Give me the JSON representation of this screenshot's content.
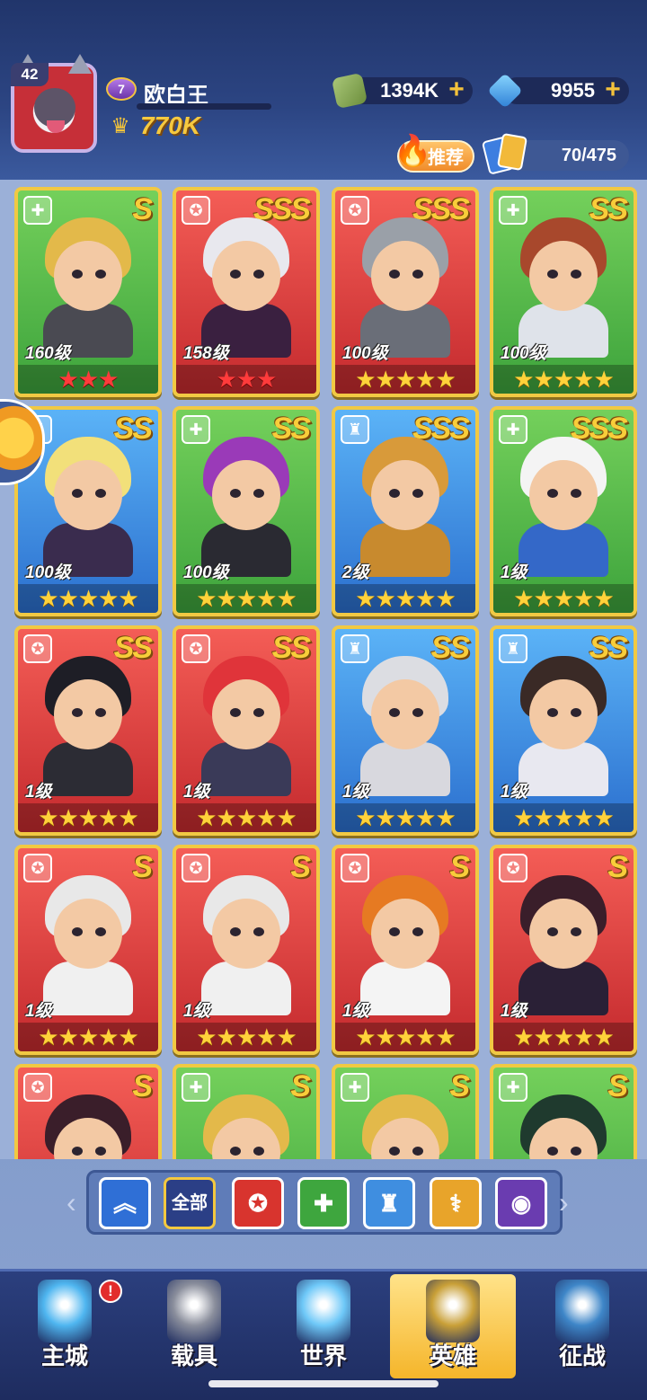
{
  "player": {
    "avatar_level": "42",
    "rank": "7",
    "name": "欧白王",
    "power": "770K"
  },
  "resources": {
    "gold": "1394K",
    "gems": "9955"
  },
  "recommend_label": "推荐",
  "collection_count": "70/475",
  "heroes": [
    {
      "grade": "S",
      "color": "green",
      "level": "160级",
      "stars": 3,
      "star_color": "red",
      "hair": "#e3b94a",
      "outfit": "#4a4a52"
    },
    {
      "grade": "SSS",
      "color": "red",
      "level": "158级",
      "stars": 3,
      "star_color": "red",
      "hair": "#e8e8ee",
      "outfit": "#3a2040"
    },
    {
      "grade": "SSS",
      "color": "red",
      "level": "100级",
      "stars": 5,
      "star_color": "gold",
      "hair": "#9aa0a8",
      "outfit": "#6a6e78"
    },
    {
      "grade": "SS",
      "color": "green",
      "level": "100级",
      "stars": 5,
      "star_color": "gold",
      "hair": "#a8482c",
      "outfit": "#dfe3ea"
    },
    {
      "grade": "SS",
      "color": "blue",
      "level": "100级",
      "stars": 5,
      "star_color": "gold",
      "hair": "#f2e07a",
      "outfit": "#3a2c4e"
    },
    {
      "grade": "SS",
      "color": "green",
      "level": "100级",
      "stars": 5,
      "star_color": "gold",
      "hair": "#9a3ab8",
      "outfit": "#2a2a32"
    },
    {
      "grade": "SSS",
      "color": "blue",
      "level": "2级",
      "stars": 5,
      "star_color": "gold",
      "hair": "#d89a3a",
      "outfit": "#c88a2e"
    },
    {
      "grade": "SSS",
      "color": "green",
      "level": "1级",
      "stars": 5,
      "star_color": "gold",
      "hair": "#f4f4f4",
      "outfit": "#3468c8"
    },
    {
      "grade": "SS",
      "color": "red",
      "level": "1级",
      "stars": 5,
      "star_color": "gold",
      "hair": "#1e1e26",
      "outfit": "#2c2c34"
    },
    {
      "grade": "SS",
      "color": "red",
      "level": "1级",
      "stars": 5,
      "star_color": "gold",
      "hair": "#e0343a",
      "outfit": "#3a3a58"
    },
    {
      "grade": "SS",
      "color": "blue",
      "level": "1级",
      "stars": 5,
      "star_color": "gold",
      "hair": "#dcdde2",
      "outfit": "#d8d8de"
    },
    {
      "grade": "SS",
      "color": "blue",
      "level": "1级",
      "stars": 5,
      "star_color": "gold",
      "hair": "#3a2a26",
      "outfit": "#e8e8f0"
    },
    {
      "grade": "S",
      "color": "red",
      "level": "1级",
      "stars": 5,
      "star_color": "gold",
      "hair": "#e8e8e8",
      "outfit": "#f0f0f0"
    },
    {
      "grade": "S",
      "color": "red",
      "level": "1级",
      "stars": 5,
      "star_color": "gold",
      "hair": "#e8e8e8",
      "outfit": "#f0f0f0"
    },
    {
      "grade": "S",
      "color": "red",
      "level": "1级",
      "stars": 5,
      "star_color": "gold",
      "hair": "#e67a22",
      "outfit": "#f4f4f4"
    },
    {
      "grade": "S",
      "color": "red",
      "level": "1级",
      "stars": 5,
      "star_color": "gold",
      "hair": "#3a1e2a",
      "outfit": "#2a2036"
    },
    {
      "grade": "S",
      "color": "red",
      "level": "",
      "stars": 0,
      "star_color": "gold",
      "hair": "#3a1e2a",
      "outfit": "#2a2036"
    },
    {
      "grade": "S",
      "color": "green",
      "level": "",
      "stars": 0,
      "star_color": "gold",
      "hair": "#e3b94a",
      "outfit": "#4a4a52"
    },
    {
      "grade": "S",
      "color": "green",
      "level": "",
      "stars": 0,
      "star_color": "gold",
      "hair": "#e3b94a",
      "outfit": "#4a4a52"
    },
    {
      "grade": "S",
      "color": "green",
      "level": "",
      "stars": 0,
      "star_color": "gold",
      "hair": "#1f3a2e",
      "outfit": "#5a2e8a"
    }
  ],
  "filters": [
    {
      "icon": "chevron-up-icon",
      "glyph": "︽",
      "color": "#2f6fd6",
      "label": ""
    },
    {
      "icon": "all-filter",
      "glyph": "",
      "color": "#2b3f86",
      "label": "全部"
    },
    {
      "icon": "red-emblem-icon",
      "glyph": "✪",
      "color": "#d8342e",
      "label": ""
    },
    {
      "icon": "green-emblem-icon",
      "glyph": "✚",
      "color": "#3ea63e",
      "label": ""
    },
    {
      "icon": "blue-emblem-icon",
      "glyph": "♜",
      "color": "#3f8ee0",
      "label": ""
    },
    {
      "icon": "gold-emblem-icon",
      "glyph": "⚕",
      "color": "#e8a42a",
      "label": ""
    },
    {
      "icon": "purple-emblem-icon",
      "glyph": "◉",
      "color": "#6a3cb0",
      "label": ""
    }
  ],
  "nav": [
    {
      "label": "主城",
      "icon": "city-icon",
      "color": "#4fb6f0"
    },
    {
      "label": "载具",
      "icon": "vehicle-icon",
      "color": "#8a8e9c"
    },
    {
      "label": "世界",
      "icon": "world-icon",
      "color": "#6ec8f8"
    },
    {
      "label": "英雄",
      "icon": "hero-icon",
      "color": "#c9a038"
    },
    {
      "label": "征战",
      "icon": "campaign-icon",
      "color": "#3e86c8"
    }
  ],
  "nav_alert": "!"
}
